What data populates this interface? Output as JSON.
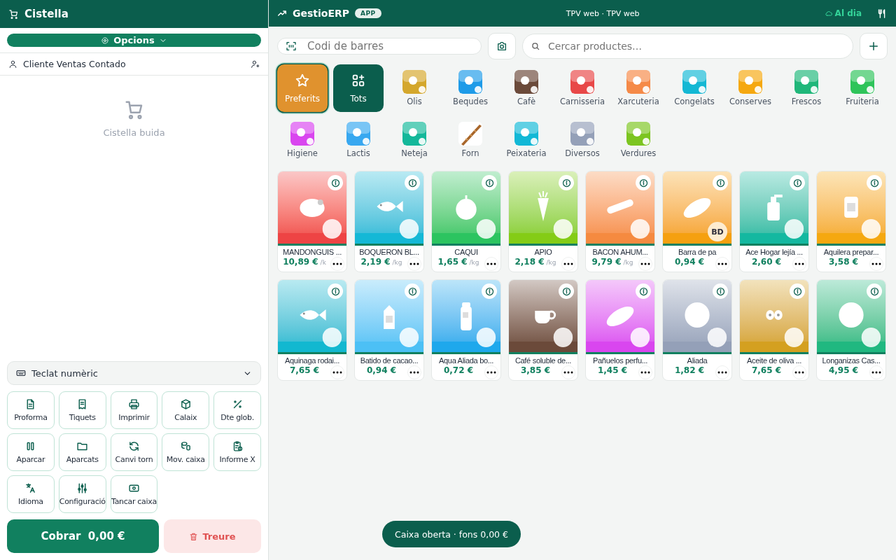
{
  "basket": {
    "title": "Cistella",
    "options_button": "Opcions",
    "customer": "Cliente Ventas Contado",
    "empty_text": "Cistella buida",
    "keypad_toggle": "Teclat numèric",
    "actions": [
      "Proforma",
      "Tiquets",
      "Imprimir",
      "Calaix",
      "Dte glob.",
      "Aparcar",
      "Aparcats",
      "Canvi torn",
      "Mov. caixa",
      "Informe X",
      "Idioma",
      "Configuració",
      "Tancar caixa"
    ],
    "charge_button": "Cobrar  0,00 €",
    "remove_button": "Treure"
  },
  "topbar": {
    "brand": "GestioERP",
    "badge": "APP",
    "title": "TPV web · TPV web",
    "sync_status": "Al dia"
  },
  "search": {
    "barcode_placeholder": "Codi de barres",
    "product_placeholder": "Cercar productes…"
  },
  "categories": [
    {
      "label": "Preferits",
      "kind": "favorites",
      "selected": true
    },
    {
      "label": "Tots",
      "kind": "all",
      "selected": false
    },
    {
      "label": "Olis",
      "kind": "category",
      "color": "#d4a72c",
      "selected": false
    },
    {
      "label": "Bequdes",
      "kind": "category",
      "color": "#1e9be8",
      "selected": false
    },
    {
      "label": "Cafè",
      "kind": "category",
      "color": "#6b4a3a",
      "selected": false
    },
    {
      "label": "Carnisseria",
      "kind": "category",
      "color": "#e84848",
      "selected": false
    },
    {
      "label": "Xarcuteria",
      "kind": "category",
      "color": "#f58a48",
      "selected": false
    },
    {
      "label": "Congelats",
      "kind": "category",
      "color": "#14b8d4",
      "selected": false
    },
    {
      "label": "Conserves",
      "kind": "category",
      "color": "#f5a810",
      "selected": false
    },
    {
      "label": "Frescos",
      "kind": "category",
      "color": "#20b77a",
      "selected": false
    },
    {
      "label": "Fruiteria",
      "kind": "category",
      "color": "#2fc45a",
      "selected": false
    },
    {
      "label": "Higiene",
      "kind": "category",
      "color": "#d946ef",
      "selected": false
    },
    {
      "label": "Lactis",
      "kind": "category",
      "color": "#38a8f0",
      "selected": false
    },
    {
      "label": "Neteja",
      "kind": "category",
      "color": "#14b89a",
      "selected": false
    },
    {
      "label": "Forn",
      "kind": "picture",
      "selected": false
    },
    {
      "label": "Peixateria",
      "kind": "category",
      "color": "#12b8d6",
      "selected": false
    },
    {
      "label": "Diversos",
      "kind": "category",
      "color": "#94a0b8",
      "selected": false
    },
    {
      "label": "Verdures",
      "kind": "category",
      "color": "#7cc520",
      "selected": false
    }
  ],
  "products": [
    {
      "name": "MANDONGUIS ...",
      "price": "10,89 €",
      "unit": "/k",
      "color": "#ee4444",
      "kind": "blob"
    },
    {
      "name": "BOQUERON BL...",
      "price": "2,19 €",
      "unit": "/kg",
      "color": "#14b8d6",
      "kind": "fish"
    },
    {
      "name": "CAQUI",
      "price": "1,65 €",
      "unit": "/kg",
      "color": "#2cc460",
      "kind": "fruit"
    },
    {
      "name": "APIO",
      "price": "2,18 €",
      "unit": "/kg",
      "color": "#84cc16",
      "kind": "carrot"
    },
    {
      "name": "BACON AHUM...",
      "price": "9,79 €",
      "unit": "/kg",
      "color": "#f58a40",
      "kind": "bacon"
    },
    {
      "name": "Barra de pa",
      "price": "0,94 €",
      "color": "#f5a010",
      "kind": "bread",
      "badge": "BD"
    },
    {
      "name": "Ace Hogar lejía ...",
      "price": "2,60 €",
      "color": "#14b8a0",
      "kind": "spray"
    },
    {
      "name": "Aquilera prepar...",
      "price": "3,58 €",
      "color": "#f5a810",
      "kind": "jar"
    },
    {
      "name": "Aquinaga rodai...",
      "price": "7,65 €",
      "color": "#12b8d0",
      "kind": "fish"
    },
    {
      "name": "Batido de cacao...",
      "price": "0,94 €",
      "color": "#4cc0f5",
      "kind": "carton"
    },
    {
      "name": "Aqua Aliada bo...",
      "price": "0,72 €",
      "color": "#1ea8ec",
      "kind": "bottle"
    },
    {
      "name": "Café soluble de...",
      "price": "3,85 €",
      "color": "#6b4a3a",
      "kind": "cup"
    },
    {
      "name": "Pañuelos perfu...",
      "price": "1,45 €",
      "color": "#d946ef",
      "kind": "bread"
    },
    {
      "name": "Aliada",
      "price": "1,82 €",
      "color": "#94a0b8",
      "kind": "circle"
    },
    {
      "name": "Aceite de oliva ...",
      "price": "7,65 €",
      "color": "#d4a020",
      "kind": "olives"
    },
    {
      "name": "Longanizas Cas...",
      "price": "4,95 €",
      "color": "#20b880",
      "kind": "circle"
    }
  ],
  "status_pill": "Caixa oberta · fons 0,00 €"
}
